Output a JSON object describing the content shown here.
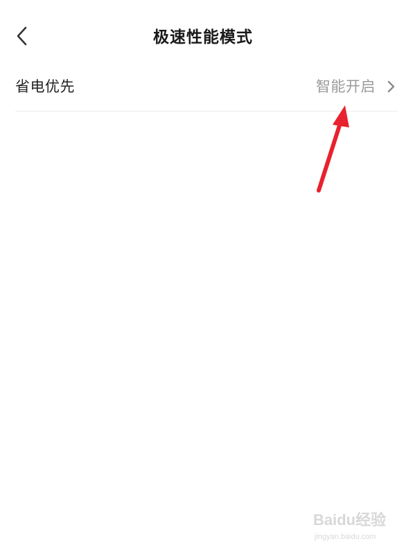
{
  "header": {
    "back_icon": "chevron-left-icon",
    "title": "极速性能模式"
  },
  "settings": {
    "power_saving": {
      "label": "省电优先",
      "value": "智能开启",
      "chevron_icon": "chevron-right-icon"
    }
  },
  "annotation": {
    "arrow_icon": "red-arrow-icon",
    "color": "#e8222e"
  },
  "watermark": {
    "brand": "Baidu经验",
    "url": "jingyan.baidu.com"
  },
  "colors": {
    "title": "#1a1a1a",
    "label": "#222222",
    "value": "#9a9a9a",
    "divider": "#ececec"
  }
}
